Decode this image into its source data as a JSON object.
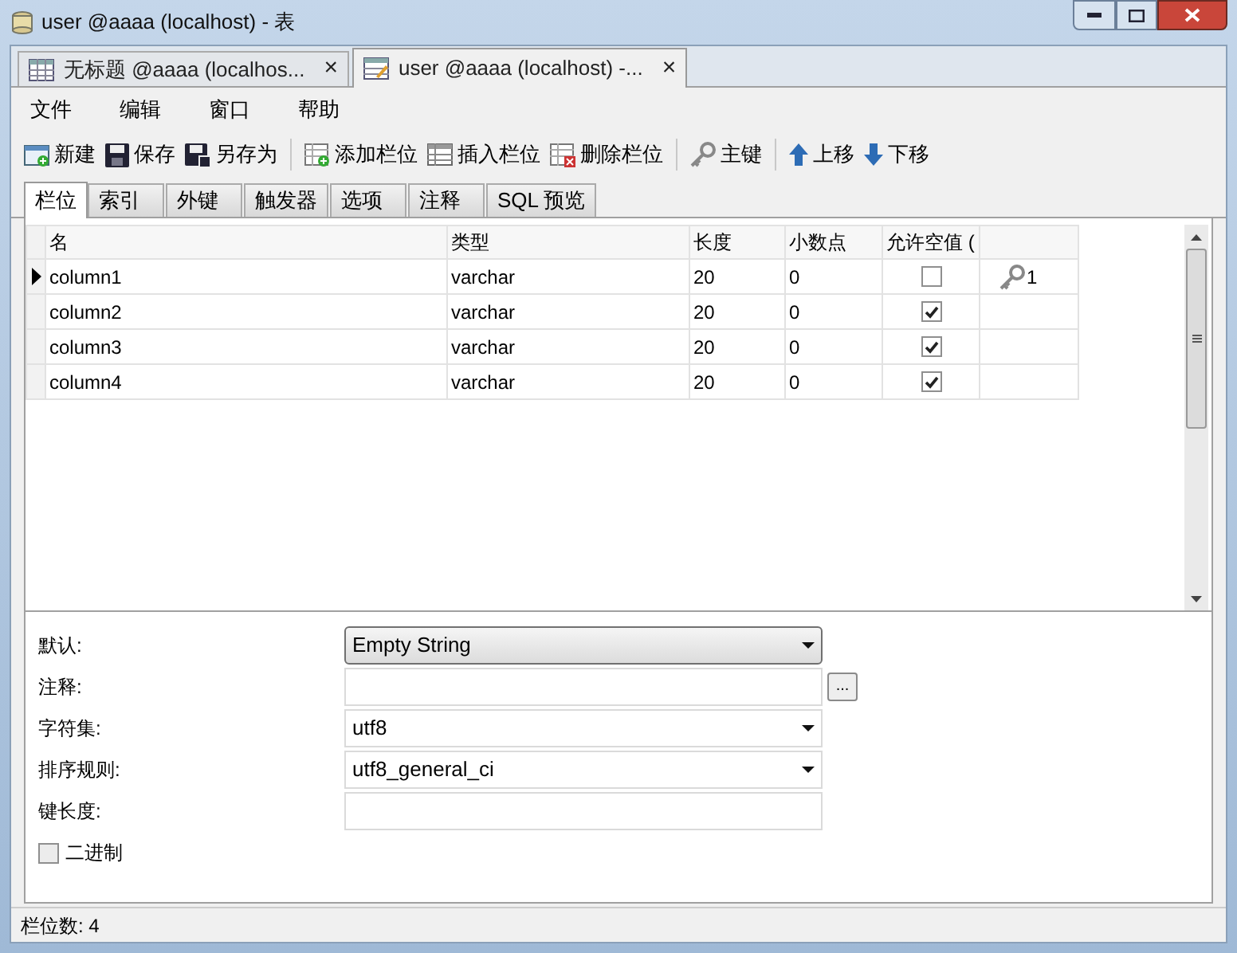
{
  "window": {
    "title": "user @aaaa (localhost) - 表"
  },
  "doc_tabs": [
    {
      "label": "无标题 @aaaa (localhos...",
      "close": "×",
      "selected": false,
      "kind": "table"
    },
    {
      "label": "user @aaaa (localhost) -...",
      "close": "×",
      "selected": true,
      "kind": "design"
    }
  ],
  "menu": [
    "文件",
    "编辑",
    "窗口",
    "帮助"
  ],
  "toolbar": [
    {
      "label": "新建",
      "kind": "new"
    },
    {
      "label": "保存",
      "kind": "save"
    },
    {
      "label": "另存为",
      "kind": "saveas"
    },
    {
      "kind": "sep"
    },
    {
      "label": "添加栏位",
      "kind": "add"
    },
    {
      "label": "插入栏位",
      "kind": "insert"
    },
    {
      "label": "删除栏位",
      "kind": "delete"
    },
    {
      "kind": "sep"
    },
    {
      "label": "主键",
      "kind": "key"
    },
    {
      "kind": "sep"
    },
    {
      "label": "上移",
      "kind": "up"
    },
    {
      "label": "下移",
      "kind": "down"
    }
  ],
  "tabs": [
    {
      "label": "栏位",
      "selected": true
    },
    {
      "label": "索引",
      "selected": false
    },
    {
      "label": "外键",
      "selected": false
    },
    {
      "label": "触发器",
      "selected": false
    },
    {
      "label": "选项",
      "selected": false
    },
    {
      "label": "注释",
      "selected": false
    },
    {
      "label": "SQL 预览",
      "selected": false
    }
  ],
  "table": {
    "columns": [
      "名",
      "类型",
      "长度",
      "小数点",
      "允许空值 ("
    ],
    "rows": [
      {
        "selected": true,
        "cells": [
          "column1",
          "varchar",
          "20",
          "0"
        ],
        "allow_null": false,
        "key": "1"
      },
      {
        "selected": false,
        "cells": [
          "column2",
          "varchar",
          "20",
          "0"
        ],
        "allow_null": true
      },
      {
        "selected": false,
        "cells": [
          "column3",
          "varchar",
          "20",
          "0"
        ],
        "allow_null": true
      },
      {
        "selected": false,
        "cells": [
          "column4",
          "varchar",
          "20",
          "0"
        ],
        "allow_null": true
      }
    ]
  },
  "properties": [
    {
      "label": "默认:",
      "kind": "combo",
      "value": "Empty String"
    },
    {
      "label": "注释:",
      "kind": "text-ellipsis",
      "button": "..."
    },
    {
      "label": "字符集:",
      "kind": "dropdown",
      "value": "utf8"
    },
    {
      "label": "排序规则:",
      "kind": "dropdown",
      "value": "utf8_general_ci"
    },
    {
      "label": "键长度:",
      "kind": "text"
    }
  ],
  "binary": {
    "label": "二进制",
    "checked": false
  },
  "status_bar": "栏位数: 4"
}
